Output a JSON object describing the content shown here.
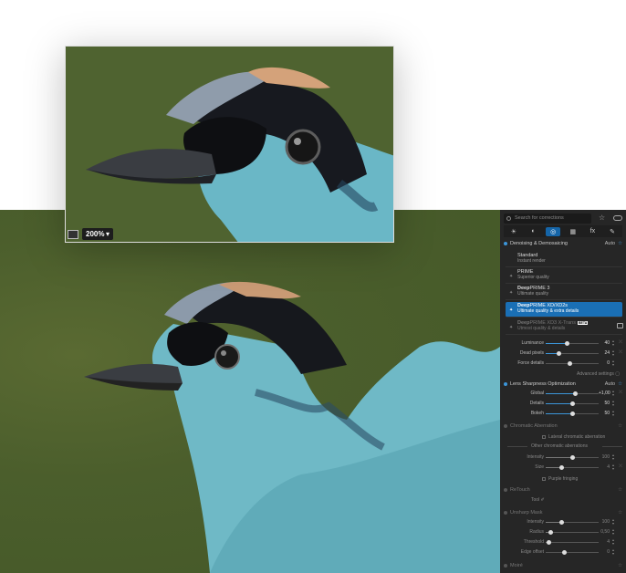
{
  "zoom": {
    "value": "200%",
    "caret": "▾"
  },
  "panel": {
    "search_placeholder": "Search for corrections",
    "tabs": [
      "☀",
      "◐",
      "◎",
      "▦",
      "fx",
      "✎"
    ],
    "denoise": {
      "title": "Denoising & Demosaicing",
      "auto": "Auto",
      "options": [
        {
          "title": "Standard",
          "sub": "Instant render"
        },
        {
          "title": "PRIME",
          "sub": "Superior quality"
        },
        {
          "title_bold": "Deep",
          "title_rest": "PRIME 3",
          "sub": "Ultimate quality"
        },
        {
          "title_bold": "Deep",
          "title_rest": "PRIME XD/XD2s",
          "sub": "Ultimate quality & extra details"
        },
        {
          "title_bold": "Deep",
          "title_rest": "PRIME XD3 X-Trans",
          "sub": "Utmost quality & details",
          "badge": "BETA"
        }
      ],
      "sliders": [
        {
          "label": "Luminance",
          "value": "40",
          "frac": 0.4
        },
        {
          "label": "Dead pixels",
          "value": "24",
          "frac": 0.24
        },
        {
          "label": "Force details",
          "value": "0",
          "frac": 0.45
        }
      ],
      "advanced": "Advanced settings"
    },
    "lens": {
      "title": "Lens Sharpness Optimization",
      "auto": "Auto",
      "sliders": [
        {
          "label": "Global",
          "value": "+1,00",
          "frac": 0.55
        },
        {
          "label": "Details",
          "value": "50",
          "frac": 0.5
        },
        {
          "label": "Bokeh",
          "value": "50",
          "frac": 0.5
        }
      ]
    },
    "chromatic": {
      "title": "Chromatic Aberration",
      "lateral": "Lateral chromatic aberration",
      "other": "Other chromatic aberrations",
      "sliders": [
        {
          "label": "Intensity",
          "value": "100",
          "frac": 0.5
        },
        {
          "label": "Size",
          "value": "4",
          "frac": 0.3
        }
      ],
      "purple": "Purple fringing"
    },
    "retouch": {
      "title": "ReTouch",
      "tool": "Tool"
    },
    "unsharp": {
      "title": "Unsharp Mask",
      "sliders": [
        {
          "label": "Intensity",
          "value": "100",
          "frac": 0.3
        },
        {
          "label": "Radius",
          "value": "0,50",
          "frac": 0.08
        },
        {
          "label": "Threshold",
          "value": "4",
          "frac": 0.06
        },
        {
          "label": "Edge offset",
          "value": "0",
          "frac": 0.35
        }
      ]
    },
    "moire": {
      "title": "Moiré"
    }
  }
}
